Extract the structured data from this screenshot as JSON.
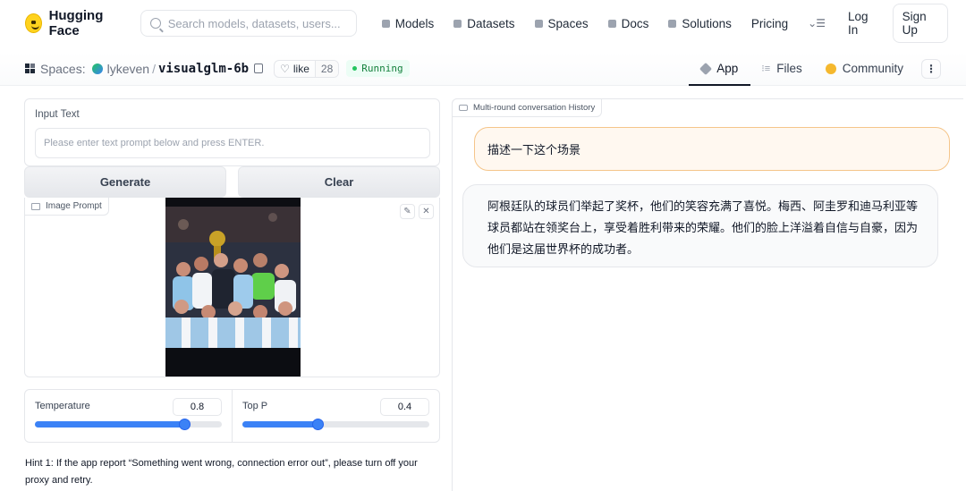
{
  "nav": {
    "brand": "Hugging Face",
    "search_placeholder": "Search models, datasets, users...",
    "links": [
      "Models",
      "Datasets",
      "Spaces",
      "Docs",
      "Solutions",
      "Pricing"
    ],
    "login": "Log In",
    "signup": "Sign Up"
  },
  "space": {
    "section": "Spaces:",
    "owner": "lykeven",
    "separator": "/",
    "repo": "visualglm-6b",
    "like_label": "like",
    "like_count": "28",
    "status": "Running",
    "tabs": [
      "App",
      "Files",
      "Community"
    ],
    "active_tab": "App"
  },
  "left": {
    "input_label": "Input Text",
    "input_placeholder": "Please enter text prompt below and press ENTER.",
    "generate_label": "Generate",
    "clear_label": "Clear",
    "image_label": "Image Prompt",
    "temperature": {
      "label": "Temperature",
      "value": "0.8",
      "fraction": 0.8
    },
    "top_p": {
      "label": "Top P",
      "value": "0.4",
      "fraction": 0.4
    },
    "hint": "Hint 1: If the app report “Something went wrong, connection error out”, please turn off your proxy and retry."
  },
  "right": {
    "history_label": "Multi-round conversation History",
    "user_message": "描述一下这个场景",
    "bot_message": "阿根廷队的球员们举起了奖杯，他们的笑容充满了喜悦。梅西、阿圭罗和迪马利亚等球员都站在领奖台上，享受着胜利带来的荣耀。他们的脸上洋溢着自信与自豪，因为他们是这届世界杯的成功者。"
  },
  "colors": {
    "accent": "#3b82f6",
    "running_green": "#15803d",
    "user_bubble_border": "#f5c58a"
  }
}
